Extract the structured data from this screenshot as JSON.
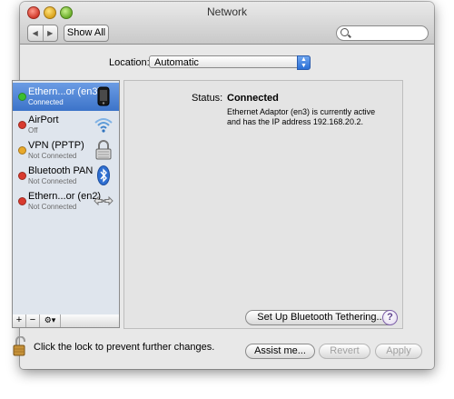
{
  "window": {
    "title": "Network",
    "back_icon": "back-arrow-icon",
    "forward_icon": "forward-arrow-icon",
    "show_all_label": "Show All",
    "search": {
      "value": "",
      "placeholder": ""
    }
  },
  "location": {
    "label": "Location:",
    "value": "Automatic"
  },
  "services": [
    {
      "name": "Ethern...or (en3)",
      "status": "Connected",
      "status_color": "#3bbf2f",
      "icon": "ethernet-phone-icon",
      "selected": true
    },
    {
      "name": "AirPort",
      "status": "Off",
      "status_color": "#d93a2e",
      "icon": "wifi-icon",
      "selected": false
    },
    {
      "name": "VPN (PPTP)",
      "status": "Not Connected",
      "status_color": "#e8a92b",
      "icon": "vpn-lock-icon",
      "selected": false
    },
    {
      "name": "Bluetooth PAN",
      "status": "Not Connected",
      "status_color": "#d93a2e",
      "icon": "bluetooth-icon",
      "selected": false
    },
    {
      "name": "Ethern...or (en2)",
      "status": "Not Connected",
      "status_color": "#d93a2e",
      "icon": "ethernet-arrows-icon",
      "selected": false
    }
  ],
  "sidebar_buttons": {
    "add": "+",
    "remove": "−",
    "action": "⚙▾"
  },
  "detail": {
    "status_label": "Status:",
    "status_value": "Connected",
    "status_description": "Ethernet Adaptor (en3) is currently active and has the IP address 192.168.20.2."
  },
  "buttons": {
    "tethering": "Set Up Bluetooth Tethering...",
    "help": "?",
    "assist": "Assist me...",
    "revert": "Revert",
    "apply": "Apply"
  },
  "lock_text": "Click the lock to prevent further changes."
}
